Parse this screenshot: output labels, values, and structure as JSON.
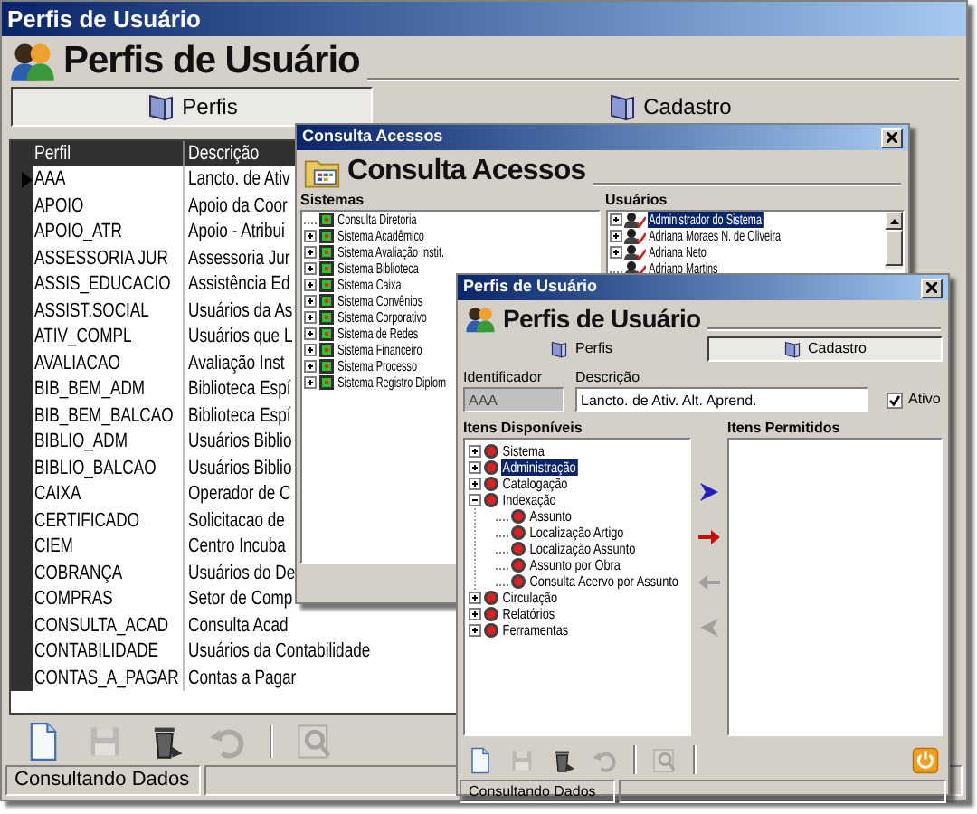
{
  "main_window": {
    "title": "Perfis de Usuário",
    "header": "Perfis de Usuário",
    "tabs": [
      {
        "label": "Perfis",
        "selected": true
      },
      {
        "label": "Cadastro",
        "selected": false
      }
    ],
    "grid": {
      "columns": [
        "Perfil",
        "Descrição"
      ],
      "rows": [
        {
          "perfil": "AAA",
          "descricao": "Lancto. de Ativ",
          "current": true
        },
        {
          "perfil": "APOIO",
          "descricao": "Apoio da Coor",
          "current": false
        },
        {
          "perfil": "APOIO_ATR",
          "descricao": "Apoio - Atribui",
          "current": false
        },
        {
          "perfil": "ASSESSORIA JUR",
          "descricao": "Assessoria Jur",
          "current": false
        },
        {
          "perfil": "ASSIS_EDUCACIO",
          "descricao": "Assistência Ed",
          "current": false
        },
        {
          "perfil": "ASSIST.SOCIAL",
          "descricao": "Usuários da As",
          "current": false
        },
        {
          "perfil": "ATIV_COMPL",
          "descricao": "Usuários que L",
          "current": false
        },
        {
          "perfil": "AVALIACAO",
          "descricao": "Avaliação Inst",
          "current": false
        },
        {
          "perfil": "BIB_BEM_ADM",
          "descricao": "Biblioteca Espí",
          "current": false
        },
        {
          "perfil": "BIB_BEM_BALCAO",
          "descricao": "Biblioteca Espí",
          "current": false
        },
        {
          "perfil": "BIBLIO_ADM",
          "descricao": "Usuários Biblio",
          "current": false
        },
        {
          "perfil": "BIBLIO_BALCAO",
          "descricao": "Usuários Biblio",
          "current": false
        },
        {
          "perfil": "CAIXA",
          "descricao": "Operador de C",
          "current": false
        },
        {
          "perfil": "CERTIFICADO",
          "descricao": "Solicitacao de",
          "current": false
        },
        {
          "perfil": "CIEM",
          "descricao": "Centro Incuba",
          "current": false
        },
        {
          "perfil": "COBRANÇA",
          "descricao": "Usuários do De",
          "current": false
        },
        {
          "perfil": "COMPRAS",
          "descricao": "Setor de Comp",
          "current": false
        },
        {
          "perfil": "CONSULTA_ACAD",
          "descricao": "Consulta Acad",
          "current": false
        },
        {
          "perfil": "CONTABILIDADE",
          "descricao": "Usuários da Contabilidade",
          "current": false
        },
        {
          "perfil": "CONTAS_A_PAGAR",
          "descricao": "Contas a Pagar",
          "current": false
        }
      ]
    },
    "toolbar": [
      {
        "kind": "new",
        "disabled": false
      },
      {
        "kind": "save",
        "disabled": true
      },
      {
        "kind": "delete",
        "disabled": false
      },
      {
        "kind": "undo",
        "disabled": true
      },
      {
        "kind": "separator"
      },
      {
        "kind": "search",
        "disabled": true
      }
    ],
    "status_bar": "Consultando Dados"
  },
  "access_window": {
    "title": "Consulta Acessos",
    "header": "Consulta Acessos",
    "sistemas": {
      "label": "Sistemas",
      "items": [
        {
          "label": "Consulta Diretoria",
          "expandable": false
        },
        {
          "label": "Sistema Acadêmico",
          "expandable": true
        },
        {
          "label": "Sistema Avaliação Instit.",
          "expandable": true
        },
        {
          "label": "Sistema Biblioteca",
          "expandable": true
        },
        {
          "label": "Sistema Caixa",
          "expandable": true
        },
        {
          "label": "Sistema Convênios",
          "expandable": true
        },
        {
          "label": "Sistema Corporativo",
          "expandable": true
        },
        {
          "label": "Sistema de Redes",
          "expandable": true
        },
        {
          "label": "Sistema Financeiro",
          "expandable": true
        },
        {
          "label": "Sistema Processo",
          "expandable": true
        },
        {
          "label": "Sistema Registro Diplom",
          "expandable": true
        }
      ]
    },
    "usuarios": {
      "label": "Usuários",
      "items": [
        {
          "label": "Administrador do Sistema",
          "expandable": true,
          "selected": true
        },
        {
          "label": "Adriana Moraes N. de Oliveira",
          "expandable": true,
          "selected": false
        },
        {
          "label": "Adriana Neto",
          "expandable": true,
          "selected": false
        },
        {
          "label": "Adriano Martins",
          "expandable": false,
          "selected": false
        }
      ]
    }
  },
  "profile_window": {
    "title": "Perfis de Usuário",
    "header": "Perfis de Usuário",
    "tabs": [
      {
        "label": "Perfis",
        "selected": false
      },
      {
        "label": "Cadastro",
        "selected": true
      }
    ],
    "identificador": {
      "label": "Identificador",
      "value": "AAA",
      "disabled": true
    },
    "descricao": {
      "label": "Descrição",
      "value": "Lancto. de Ativ. Alt. Aprend."
    },
    "ativo": {
      "label": "Ativo",
      "checked": true
    },
    "disponiveis": {
      "label": "Itens Disponíveis",
      "items": [
        {
          "label": "Sistema",
          "expandable": true,
          "expanded": false,
          "selected": false
        },
        {
          "label": "Administração",
          "expandable": true,
          "expanded": false,
          "selected": true
        },
        {
          "label": "Catalogação",
          "expandable": true,
          "expanded": false,
          "selected": false
        },
        {
          "label": "Indexação",
          "expandable": true,
          "expanded": true,
          "selected": false,
          "children": [
            {
              "label": "Assunto",
              "expandable": false,
              "selected": false
            },
            {
              "label": "Localização Artigo",
              "expandable": false,
              "selected": false
            },
            {
              "label": "Localização Assunto",
              "expandable": false,
              "selected": false
            },
            {
              "label": "Assunto por Obra",
              "expandable": false,
              "selected": false
            },
            {
              "label": "Consulta Acervo por Assunto",
              "expandable": false,
              "selected": false
            }
          ]
        },
        {
          "label": "Circulação",
          "expandable": true,
          "expanded": false,
          "selected": false
        },
        {
          "label": "Relatórios",
          "expandable": true,
          "expanded": false,
          "selected": false
        },
        {
          "label": "Ferramentas",
          "expandable": true,
          "expanded": false,
          "selected": false
        }
      ]
    },
    "transfer_buttons": [
      {
        "kind": "move_right",
        "disabled": false
      },
      {
        "kind": "move_all_right",
        "disabled": false
      },
      {
        "kind": "move_left",
        "disabled": true
      },
      {
        "kind": "move_all_left",
        "disabled": true
      }
    ],
    "permitidos": {
      "label": "Itens Permitidos"
    },
    "toolbar": [
      {
        "kind": "new",
        "disabled": false
      },
      {
        "kind": "save",
        "disabled": true
      },
      {
        "kind": "delete",
        "disabled": false
      },
      {
        "kind": "undo",
        "disabled": true
      },
      {
        "kind": "separator"
      },
      {
        "kind": "search",
        "disabled": true
      },
      {
        "kind": "separator"
      },
      {
        "kind": "power",
        "disabled": false
      }
    ],
    "status_bar": "Consultando Dados"
  }
}
